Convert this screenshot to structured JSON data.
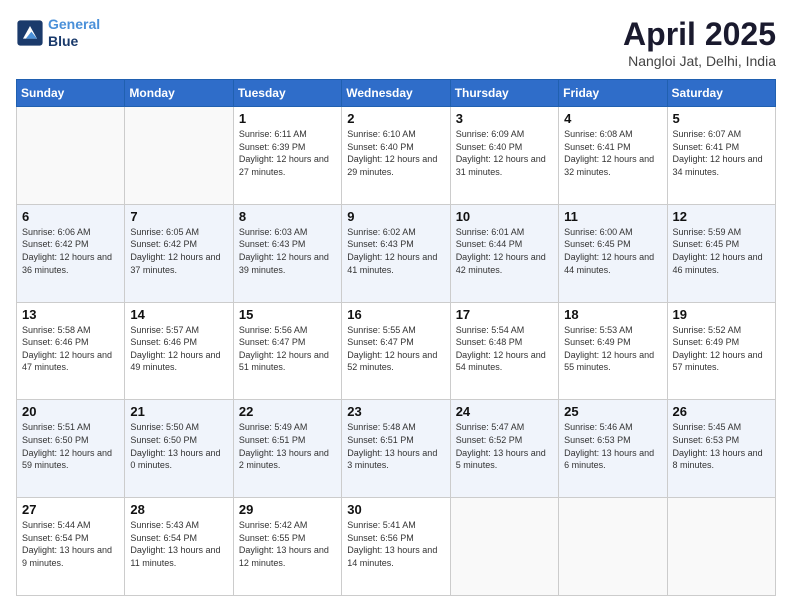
{
  "logo": {
    "line1": "General",
    "line2": "Blue"
  },
  "title": "April 2025",
  "subtitle": "Nangloi Jat, Delhi, India",
  "weekdays": [
    "Sunday",
    "Monday",
    "Tuesday",
    "Wednesday",
    "Thursday",
    "Friday",
    "Saturday"
  ],
  "weeks": [
    [
      {
        "day": "",
        "info": ""
      },
      {
        "day": "",
        "info": ""
      },
      {
        "day": "1",
        "info": "Sunrise: 6:11 AM\nSunset: 6:39 PM\nDaylight: 12 hours and 27 minutes."
      },
      {
        "day": "2",
        "info": "Sunrise: 6:10 AM\nSunset: 6:40 PM\nDaylight: 12 hours and 29 minutes."
      },
      {
        "day": "3",
        "info": "Sunrise: 6:09 AM\nSunset: 6:40 PM\nDaylight: 12 hours and 31 minutes."
      },
      {
        "day": "4",
        "info": "Sunrise: 6:08 AM\nSunset: 6:41 PM\nDaylight: 12 hours and 32 minutes."
      },
      {
        "day": "5",
        "info": "Sunrise: 6:07 AM\nSunset: 6:41 PM\nDaylight: 12 hours and 34 minutes."
      }
    ],
    [
      {
        "day": "6",
        "info": "Sunrise: 6:06 AM\nSunset: 6:42 PM\nDaylight: 12 hours and 36 minutes."
      },
      {
        "day": "7",
        "info": "Sunrise: 6:05 AM\nSunset: 6:42 PM\nDaylight: 12 hours and 37 minutes."
      },
      {
        "day": "8",
        "info": "Sunrise: 6:03 AM\nSunset: 6:43 PM\nDaylight: 12 hours and 39 minutes."
      },
      {
        "day": "9",
        "info": "Sunrise: 6:02 AM\nSunset: 6:43 PM\nDaylight: 12 hours and 41 minutes."
      },
      {
        "day": "10",
        "info": "Sunrise: 6:01 AM\nSunset: 6:44 PM\nDaylight: 12 hours and 42 minutes."
      },
      {
        "day": "11",
        "info": "Sunrise: 6:00 AM\nSunset: 6:45 PM\nDaylight: 12 hours and 44 minutes."
      },
      {
        "day": "12",
        "info": "Sunrise: 5:59 AM\nSunset: 6:45 PM\nDaylight: 12 hours and 46 minutes."
      }
    ],
    [
      {
        "day": "13",
        "info": "Sunrise: 5:58 AM\nSunset: 6:46 PM\nDaylight: 12 hours and 47 minutes."
      },
      {
        "day": "14",
        "info": "Sunrise: 5:57 AM\nSunset: 6:46 PM\nDaylight: 12 hours and 49 minutes."
      },
      {
        "day": "15",
        "info": "Sunrise: 5:56 AM\nSunset: 6:47 PM\nDaylight: 12 hours and 51 minutes."
      },
      {
        "day": "16",
        "info": "Sunrise: 5:55 AM\nSunset: 6:47 PM\nDaylight: 12 hours and 52 minutes."
      },
      {
        "day": "17",
        "info": "Sunrise: 5:54 AM\nSunset: 6:48 PM\nDaylight: 12 hours and 54 minutes."
      },
      {
        "day": "18",
        "info": "Sunrise: 5:53 AM\nSunset: 6:49 PM\nDaylight: 12 hours and 55 minutes."
      },
      {
        "day": "19",
        "info": "Sunrise: 5:52 AM\nSunset: 6:49 PM\nDaylight: 12 hours and 57 minutes."
      }
    ],
    [
      {
        "day": "20",
        "info": "Sunrise: 5:51 AM\nSunset: 6:50 PM\nDaylight: 12 hours and 59 minutes."
      },
      {
        "day": "21",
        "info": "Sunrise: 5:50 AM\nSunset: 6:50 PM\nDaylight: 13 hours and 0 minutes."
      },
      {
        "day": "22",
        "info": "Sunrise: 5:49 AM\nSunset: 6:51 PM\nDaylight: 13 hours and 2 minutes."
      },
      {
        "day": "23",
        "info": "Sunrise: 5:48 AM\nSunset: 6:51 PM\nDaylight: 13 hours and 3 minutes."
      },
      {
        "day": "24",
        "info": "Sunrise: 5:47 AM\nSunset: 6:52 PM\nDaylight: 13 hours and 5 minutes."
      },
      {
        "day": "25",
        "info": "Sunrise: 5:46 AM\nSunset: 6:53 PM\nDaylight: 13 hours and 6 minutes."
      },
      {
        "day": "26",
        "info": "Sunrise: 5:45 AM\nSunset: 6:53 PM\nDaylight: 13 hours and 8 minutes."
      }
    ],
    [
      {
        "day": "27",
        "info": "Sunrise: 5:44 AM\nSunset: 6:54 PM\nDaylight: 13 hours and 9 minutes."
      },
      {
        "day": "28",
        "info": "Sunrise: 5:43 AM\nSunset: 6:54 PM\nDaylight: 13 hours and 11 minutes."
      },
      {
        "day": "29",
        "info": "Sunrise: 5:42 AM\nSunset: 6:55 PM\nDaylight: 13 hours and 12 minutes."
      },
      {
        "day": "30",
        "info": "Sunrise: 5:41 AM\nSunset: 6:56 PM\nDaylight: 13 hours and 14 minutes."
      },
      {
        "day": "",
        "info": ""
      },
      {
        "day": "",
        "info": ""
      },
      {
        "day": "",
        "info": ""
      }
    ]
  ]
}
